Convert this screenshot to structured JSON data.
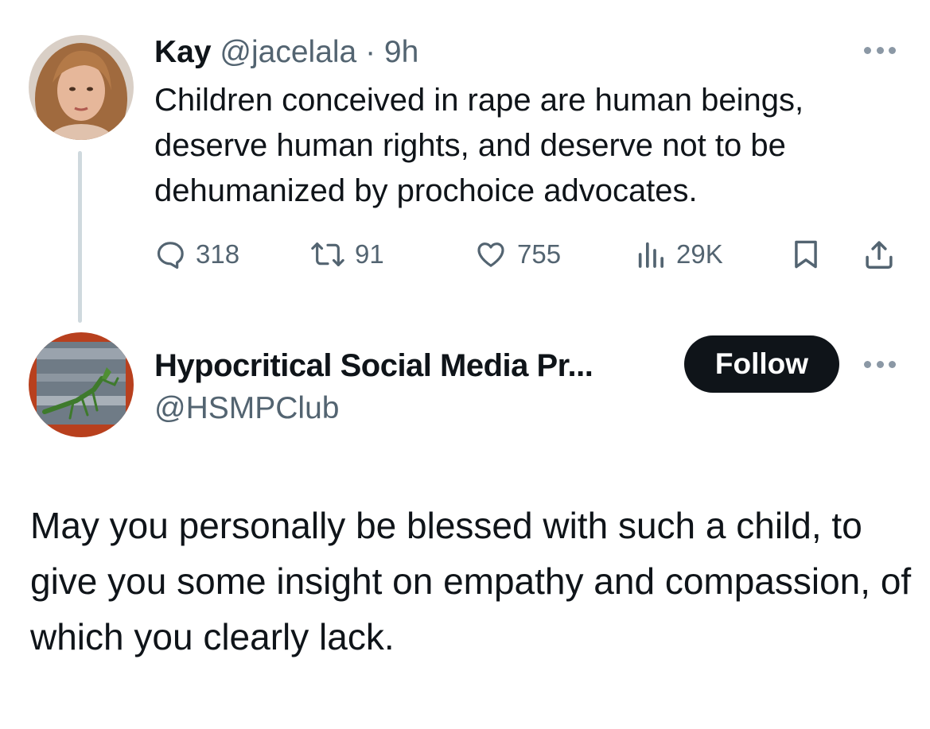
{
  "original_tweet": {
    "author_name": "Kay",
    "handle_time": "@jacelala · 9h",
    "text": "Children conceived in rape are human beings, deserve human rights, and deserve not to be dehumanized by prochoice advocates.",
    "metrics": {
      "replies": "318",
      "reposts": "91",
      "likes": "755",
      "views": "29K"
    },
    "icons": [
      "reply-icon",
      "repost-icon",
      "like-icon",
      "views-icon",
      "bookmark-icon",
      "share-icon",
      "more-icon"
    ]
  },
  "reply_tweet": {
    "author_name": "Hypocritical Social Media Pr...",
    "handle": "@HSMPClub",
    "follow_label": "Follow",
    "text": "May you personally be blessed with such a child, to give you some insight on empathy and compassion, of which you clearly lack."
  },
  "colors": {
    "text": "#0f1419",
    "secondary": "#536471",
    "thread_line": "#cfd9de",
    "follow_bg": "#0f1419"
  }
}
